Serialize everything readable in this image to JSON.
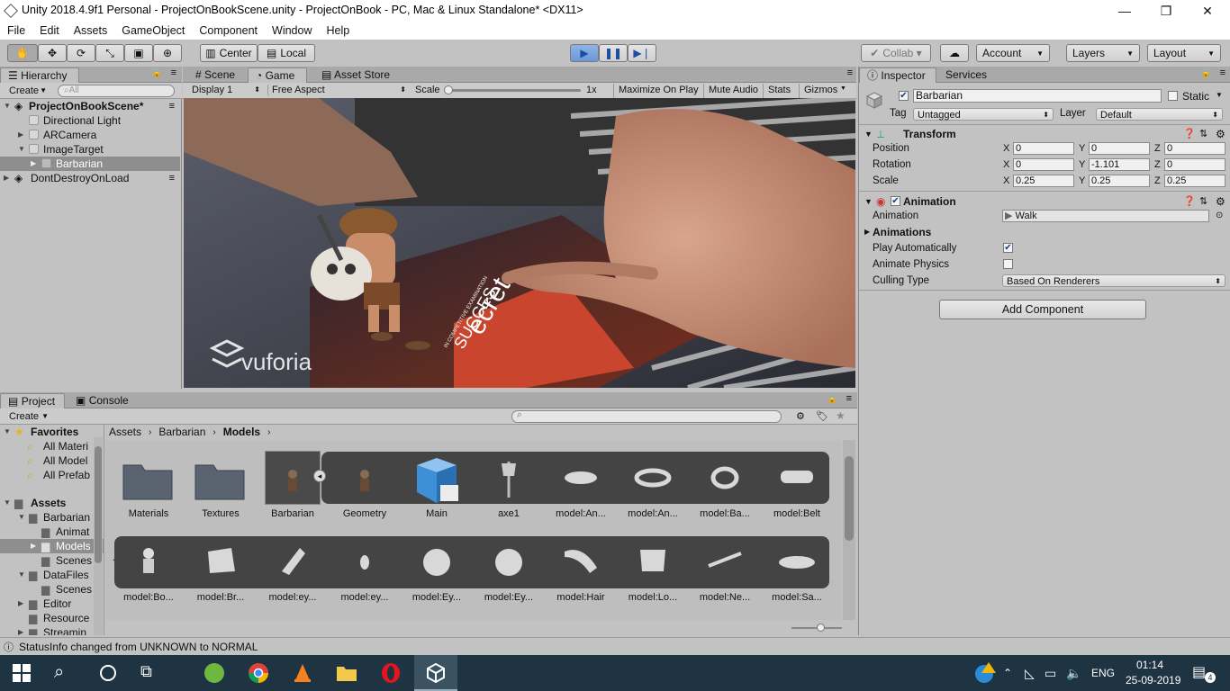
{
  "window": {
    "title": "Unity 2018.4.9f1 Personal - ProjectOnBookScene.unity - ProjectOnBook - PC, Mac & Linux Standalone* <DX11>"
  },
  "menu": [
    "File",
    "Edit",
    "Assets",
    "GameObject",
    "Component",
    "Window",
    "Help"
  ],
  "toolbar": {
    "center_label": "Center",
    "local_label": "Local",
    "collab_label": "Collab ▾",
    "account_label": "Account",
    "layers_label": "Layers",
    "layout_label": "Layout"
  },
  "hierarchy": {
    "tab": "Hierarchy",
    "create": "Create",
    "search_placeholder": "All",
    "items": [
      {
        "label": "ProjectOnBookScene*"
      },
      {
        "label": "Directional Light"
      },
      {
        "label": "ARCamera"
      },
      {
        "label": "ImageTarget"
      },
      {
        "label": "Barbarian"
      },
      {
        "label": "DontDestroyOnLoad"
      }
    ]
  },
  "center_tabs": {
    "scene": "Scene",
    "game": "Game",
    "asset_store": "Asset Store"
  },
  "game": {
    "display": "Display 1",
    "aspect": "Free Aspect",
    "scale_label": "Scale",
    "scale_value": "1x",
    "maximize": "Maximize On Play",
    "mute": "Mute Audio",
    "stats": "Stats",
    "gizmos": "Gizmos",
    "book_text1": "ecret",
    "book_text2": "SUCCES",
    "book_text3": "IN COMPETITIVE EXAMINATION",
    "watermark": "vuforia"
  },
  "inspector": {
    "tab": "Inspector",
    "services_tab": "Services",
    "object_name": "Barbarian",
    "static_label": "Static",
    "tag_label": "Tag",
    "tag_value": "Untagged",
    "layer_label": "Layer",
    "layer_value": "Default",
    "transform": {
      "title": "Transform",
      "rows": [
        {
          "label": "Position",
          "x": "0",
          "y": "0",
          "z": "0"
        },
        {
          "label": "Rotation",
          "x": "0",
          "y": "-1.101",
          "z": "0"
        },
        {
          "label": "Scale",
          "x": "0.25",
          "y": "0.25",
          "z": "0.25"
        }
      ]
    },
    "animation": {
      "title": "Animation",
      "animation_label": "Animation",
      "animation_value": "Walk",
      "animations_label": "Animations",
      "play_auto_label": "Play Automatically",
      "play_auto": true,
      "animate_physics_label": "Animate Physics",
      "animate_physics": false,
      "culling_label": "Culling Type",
      "culling_value": "Based On Renderers"
    },
    "add_component": "Add Component"
  },
  "project": {
    "tab": "Project",
    "console_tab": "Console",
    "create": "Create",
    "breadcrumb": [
      "Assets",
      "Barbarian",
      "Models"
    ],
    "favorites": {
      "label": "Favorites",
      "items": [
        "All Materi",
        "All Model",
        "All Prefab"
      ]
    },
    "tree": [
      {
        "label": "Assets",
        "bold": true
      },
      {
        "label": "Barbarian"
      },
      {
        "label": "Animat"
      },
      {
        "label": "Models"
      },
      {
        "label": "Scenes"
      },
      {
        "label": "DataFiles"
      },
      {
        "label": "Scenes"
      },
      {
        "label": "Editor"
      },
      {
        "label": "Resource"
      },
      {
        "label": "Streamin"
      }
    ],
    "row1": [
      "Materials",
      "Textures",
      "Barbarian",
      "Geometry",
      "Main",
      "axe1",
      "model:An...",
      "model:An...",
      "model:Ba...",
      "model:Belt"
    ],
    "row2": [
      "model:Bo...",
      "model:Br...",
      "model:ey...",
      "model:ey...",
      "model:Ey...",
      "model:Ey...",
      "model:Hair",
      "model:Lo...",
      "model:Ne...",
      "model:Sa..."
    ]
  },
  "status": "StatusInfo changed from UNKNOWN to NORMAL",
  "taskbar": {
    "lang": "ENG",
    "time": "01:14",
    "date": "25-09-2019",
    "notif_count": "4"
  },
  "colors": {
    "play_blue": "#6c98d6",
    "taskbar": "#1f3442",
    "selection": "#8e8e8e"
  }
}
